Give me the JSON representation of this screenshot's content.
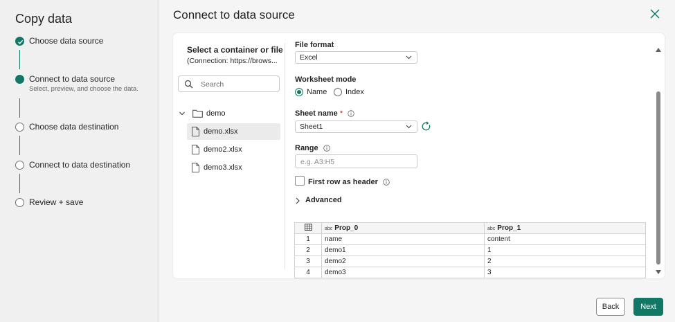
{
  "wizard": {
    "title": "Copy data",
    "steps": [
      {
        "label": "Choose data source",
        "state": "done"
      },
      {
        "label": "Connect to data source",
        "state": "current",
        "description": "Select, preview, and choose the data."
      },
      {
        "label": "Choose data destination",
        "state": "pending"
      },
      {
        "label": "Connect to data destination",
        "state": "pending"
      },
      {
        "label": "Review + save",
        "state": "pending"
      }
    ]
  },
  "dialog": {
    "title": "Connect to data source",
    "close_icon": "close-icon"
  },
  "browser": {
    "title": "Select a container or file",
    "connection": "(Connection: https://brows...",
    "search_placeholder": "Search",
    "folder": "demo",
    "files": [
      "demo.xlsx",
      "demo2.xlsx",
      "demo3.xlsx"
    ],
    "selected_file": "demo.xlsx"
  },
  "settings": {
    "file_format_label": "File format",
    "file_format_value": "Excel",
    "worksheet_mode_label": "Worksheet mode",
    "worksheet_mode_options": [
      "Name",
      "Index"
    ],
    "worksheet_mode_selected": "Name",
    "sheet_name_label": "Sheet name",
    "sheet_name_required": "*",
    "sheet_name_value": "Sheet1",
    "range_label": "Range",
    "range_placeholder": "e.g. A3:H5",
    "first_row_header_label": "First row as header",
    "first_row_header_checked": false,
    "advanced_label": "Advanced"
  },
  "preview": {
    "type_badge": "abc",
    "columns": [
      "Prop_0",
      "Prop_1"
    ],
    "rows": [
      [
        "1",
        "name",
        "content"
      ],
      [
        "2",
        "demo1",
        "1"
      ],
      [
        "3",
        "demo2",
        "2"
      ],
      [
        "4",
        "demo3",
        "3"
      ]
    ]
  },
  "footer": {
    "back_label": "Back",
    "next_label": "Next"
  },
  "colors": {
    "accent": "#117865",
    "page_bg": "#f0f0f0",
    "card_bg": "#ffffff"
  }
}
